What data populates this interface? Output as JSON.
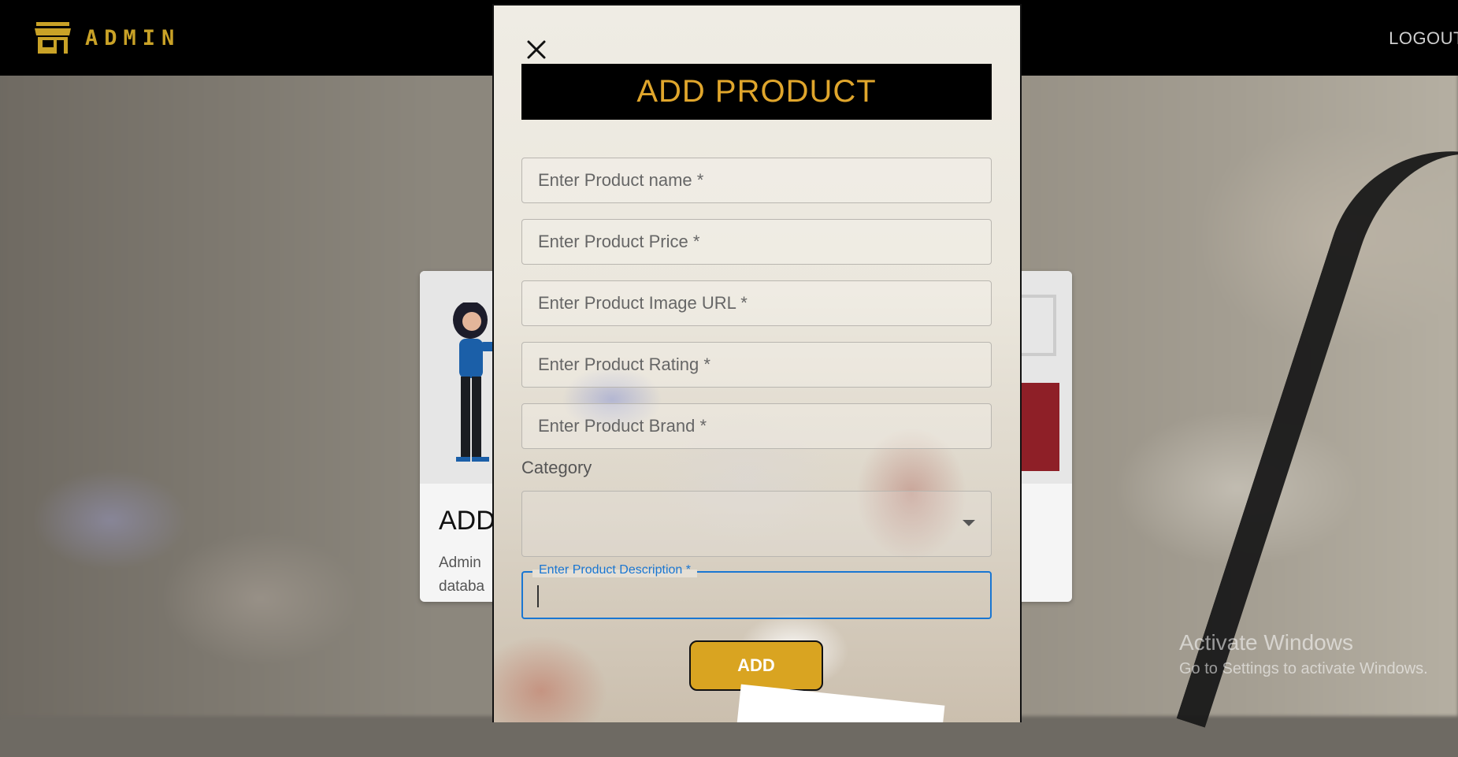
{
  "navbar": {
    "brand": "ADMIN",
    "logout": "LOGOUT",
    "brand_color": "#c9a227"
  },
  "cards": {
    "left": {
      "title": "ADD",
      "description_line1": "Admin",
      "description_line2": "databa"
    }
  },
  "modal": {
    "title": "ADD PRODUCT",
    "title_color": "#e0a62c",
    "fields": {
      "name_placeholder": "Enter Product name *",
      "price_placeholder": "Enter Product Price *",
      "image_placeholder": "Enter Product Image URL *",
      "rating_placeholder": "Enter Product Rating *",
      "brand_placeholder": "Enter Product Brand *",
      "category_label": "Category",
      "category_value": "",
      "description_label": "Enter Product Description *"
    },
    "add_button": "ADD",
    "add_button_color": "#d9a421",
    "focus_color": "#1976d2"
  },
  "watermark": {
    "title": "Activate Windows",
    "subtitle": "Go to Settings to activate Windows."
  }
}
